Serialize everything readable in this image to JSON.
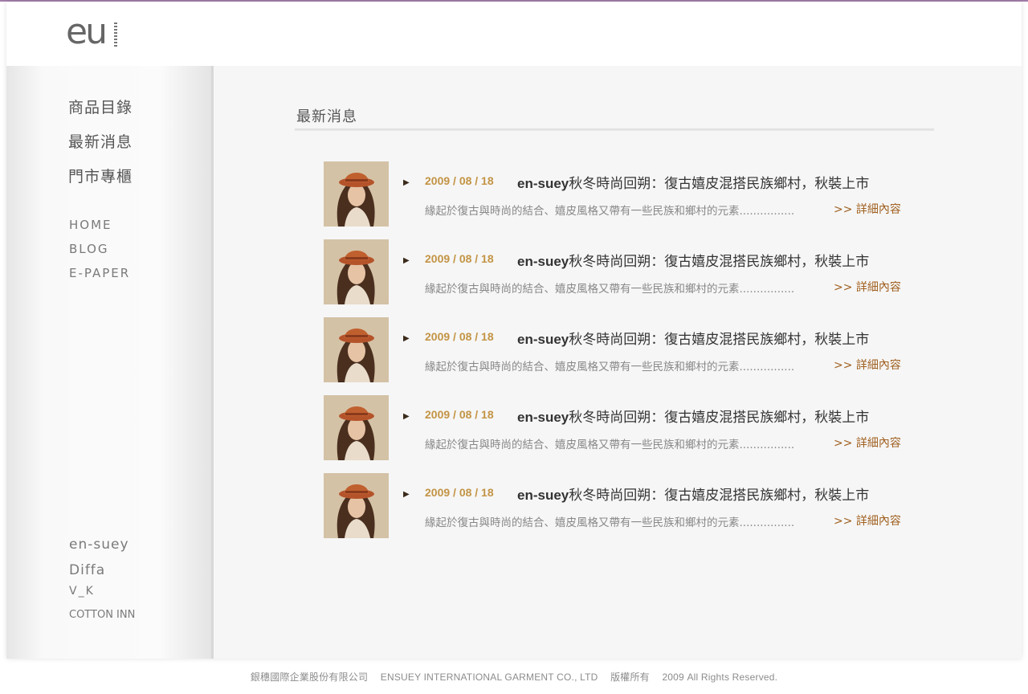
{
  "header": {
    "logo_text": "eu"
  },
  "sidebar": {
    "main_nav": [
      "商品目錄",
      "最新消息",
      "門市專櫃"
    ],
    "sub_nav": [
      "HOME",
      "BLOG",
      "E-PAPER"
    ],
    "brands": [
      "en-suey",
      "Diffa",
      "V_K",
      "COTTON INN"
    ]
  },
  "main": {
    "section_title": "最新消息",
    "news": [
      {
        "arrow": "▶",
        "date": "2009 / 08 / 18",
        "title_brand": "en-suey",
        "title_rest": "秋冬時尚回朔：復古嬉皮混搭民族鄉村，秋裝上市",
        "summary": "緣起於復古與時尚的結合、嬉皮風格又帶有一些民族和鄉村的元素................",
        "more": ">> 詳細內容"
      },
      {
        "arrow": "▶",
        "date": "2009 / 08 / 18",
        "title_brand": "en-suey",
        "title_rest": "秋冬時尚回朔：復古嬉皮混搭民族鄉村，秋裝上市",
        "summary": "緣起於復古與時尚的結合、嬉皮風格又帶有一些民族和鄉村的元素................",
        "more": ">> 詳細內容"
      },
      {
        "arrow": "▶",
        "date": "2009 / 08 / 18",
        "title_brand": "en-suey",
        "title_rest": "秋冬時尚回朔：復古嬉皮混搭民族鄉村，秋裝上市",
        "summary": "緣起於復古與時尚的結合、嬉皮風格又帶有一些民族和鄉村的元素................",
        "more": ">> 詳細內容"
      },
      {
        "arrow": "▶",
        "date": "2009 / 08 / 18",
        "title_brand": "en-suey",
        "title_rest": "秋冬時尚回朔：復古嬉皮混搭民族鄉村，秋裝上市",
        "summary": "緣起於復古與時尚的結合、嬉皮風格又帶有一些民族和鄉村的元素................",
        "more": ">> 詳細內容"
      },
      {
        "arrow": "▶",
        "date": "2009 / 08 / 18",
        "title_brand": "en-suey",
        "title_rest": "秋冬時尚回朔：復古嬉皮混搭民族鄉村，秋裝上市",
        "summary": "緣起於復古與時尚的結合、嬉皮風格又帶有一些民族和鄉村的元素................",
        "more": ">> 詳細內容"
      }
    ]
  },
  "footer": {
    "company_zh": "銀穗國際企業股份有限公司",
    "company_en": "ENSUEY INTERNATIONAL GARMENT CO., LTD",
    "copyright_zh": "版權所有",
    "copyright_en": "2009 All Rights Reserved."
  },
  "colors": {
    "date": "#c39445",
    "link": "#a06020",
    "accent_line": "#a27ca8"
  }
}
